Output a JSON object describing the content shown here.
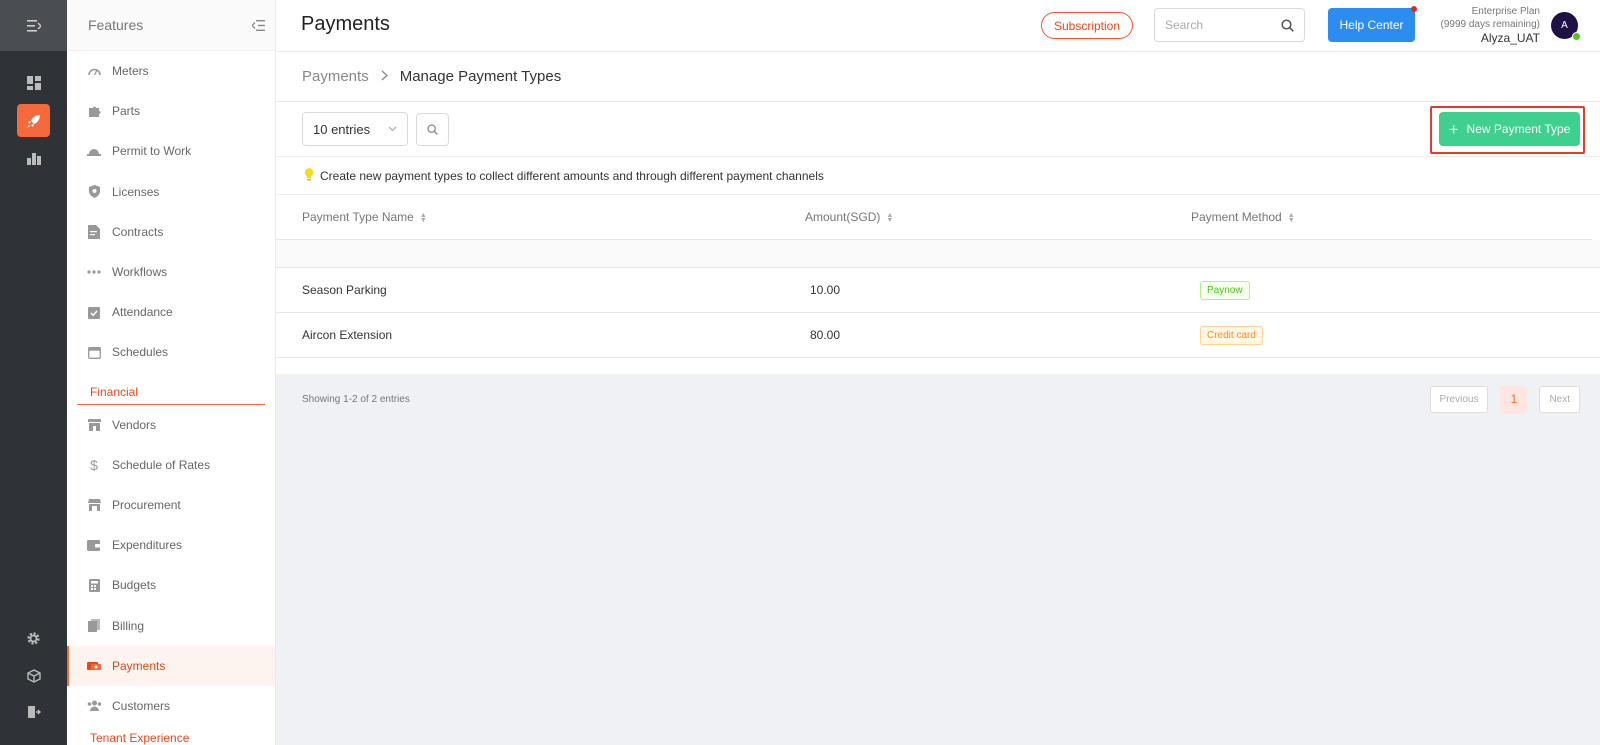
{
  "topbar": {
    "title": "Payments",
    "subscription_label": "Subscription",
    "search_placeholder": "Search",
    "help_label": "Help Center",
    "plan_name": "Enterprise Plan",
    "plan_days": "(9999 days remaining)",
    "user_name": "Alyza_UAT",
    "avatar_initial": "A"
  },
  "features": {
    "title": "Features",
    "items_top": [
      {
        "label": "Meters",
        "icon": "gauge-icon"
      },
      {
        "label": "Parts",
        "icon": "puzzle-icon"
      },
      {
        "label": "Permit to Work",
        "icon": "hardhat-icon"
      },
      {
        "label": "Licenses",
        "icon": "shield-icon"
      },
      {
        "label": "Contracts",
        "icon": "document-icon"
      },
      {
        "label": "Workflows",
        "icon": "dots-icon"
      },
      {
        "label": "Attendance",
        "icon": "checklist-icon"
      },
      {
        "label": "Schedules",
        "icon": "calendar-icon"
      }
    ],
    "section_financial": "Financial",
    "items_financial": [
      {
        "label": "Vendors",
        "icon": "store-icon"
      },
      {
        "label": "Schedule of Rates",
        "icon": "dollar-icon"
      },
      {
        "label": "Procurement",
        "icon": "shop-icon"
      },
      {
        "label": "Expenditures",
        "icon": "wallet-icon"
      },
      {
        "label": "Budgets",
        "icon": "calculator-icon"
      },
      {
        "label": "Billing",
        "icon": "billing-icon"
      },
      {
        "label": "Payments",
        "icon": "payments-icon"
      },
      {
        "label": "Customers",
        "icon": "users-icon"
      }
    ],
    "section_tenant": "Tenant Experience"
  },
  "breadcrumb": {
    "parent": "Payments",
    "current": "Manage Payment Types"
  },
  "toolbar": {
    "entries_value": "10 entries",
    "new_label": "New Payment Type"
  },
  "tip": "Create new payment types to collect different amounts and through different payment channels",
  "table": {
    "headers": [
      "Payment Type Name",
      "Amount(SGD)",
      "Payment Method"
    ],
    "rows": [
      {
        "name": "Season Parking",
        "amount": "10.00",
        "method": "Paynow",
        "method_color": "green"
      },
      {
        "name": "Aircon Extension",
        "amount": "80.00",
        "method": "Credit card",
        "method_color": "orange"
      }
    ]
  },
  "footer": {
    "showing": "Showing 1-2 of 2 entries",
    "prev": "Previous",
    "page": "1",
    "next": "Next"
  },
  "colors": {
    "accent": "#f46a3c",
    "primary": "#2d8cf0",
    "success": "#3fcf8e",
    "rail": "#2f3236"
  }
}
